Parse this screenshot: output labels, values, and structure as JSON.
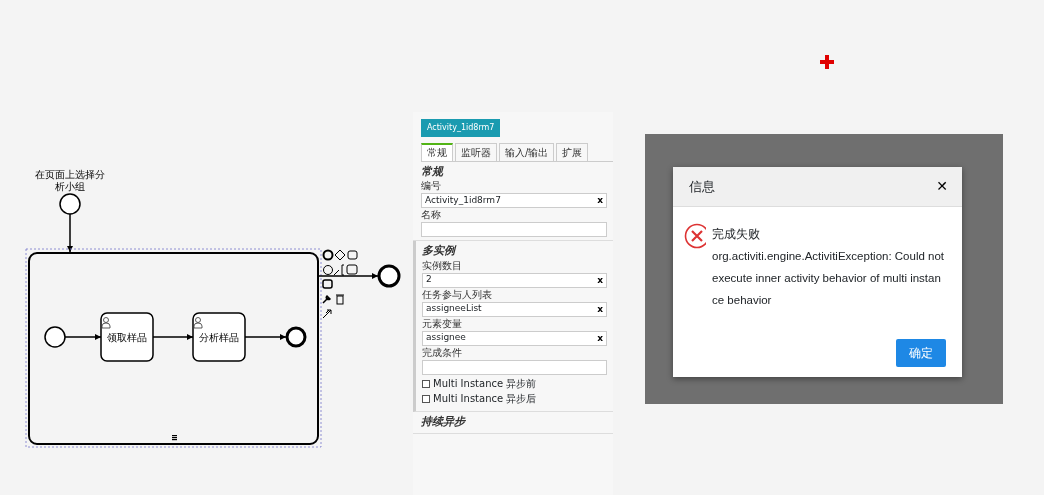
{
  "diagram": {
    "start_label": [
      "在页面上选择分",
      "析小组"
    ],
    "tasks": [
      {
        "name": "领取样品"
      },
      {
        "name": "分析样品"
      }
    ]
  },
  "panel": {
    "element_id": "Activity_1id8rm7",
    "tabs": [
      {
        "label": "常规",
        "selected": true
      },
      {
        "label": "监听器",
        "selected": false
      },
      {
        "label": "输入/输出",
        "selected": false
      },
      {
        "label": "扩展",
        "selected": false
      }
    ],
    "sections": [
      {
        "title": "常规",
        "fields": [
          {
            "kind": "text",
            "label": "编号",
            "value": "Activity_1id8rm7",
            "clear": "x"
          },
          {
            "kind": "textarea",
            "label": "名称"
          }
        ]
      },
      {
        "title": "多实例",
        "fields": [
          {
            "kind": "text",
            "label": "实例数目",
            "value": "2",
            "clear": "x"
          },
          {
            "kind": "text",
            "label": "任务参与人列表",
            "value": "assigneeList",
            "clear": "x"
          },
          {
            "kind": "text",
            "label": "元素变量",
            "value": "assignee",
            "clear": "x"
          },
          {
            "kind": "plain",
            "label": "完成条件"
          },
          {
            "kind": "checkbox",
            "label": "Multi Instance 异步前",
            "checked": false
          },
          {
            "kind": "checkbox",
            "label": "Multi Instance 异步后",
            "checked": false
          }
        ]
      },
      {
        "title": "持续异步"
      }
    ]
  },
  "dialog": {
    "title": "信息",
    "close": "✕",
    "heading": "完成失败",
    "message": "org.activiti.engine.ActivitiException: Could not execute inner activity behavior of multi instance behavior",
    "button": "确定"
  }
}
